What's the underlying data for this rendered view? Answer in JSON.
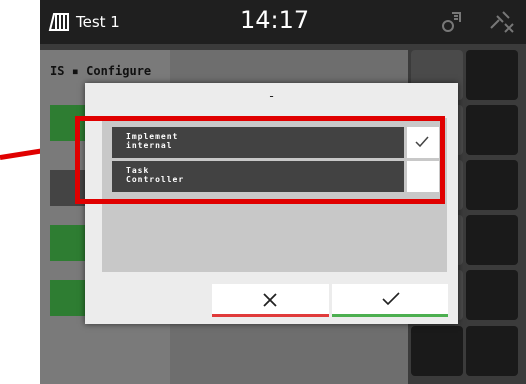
{
  "header": {
    "title": "Test 1",
    "time": "14:17"
  },
  "background": {
    "header_text": "IS ▪ Configure"
  },
  "dialog": {
    "title": "-",
    "options": [
      {
        "label": "Implement\ninternal",
        "checked": true
      },
      {
        "label": "Task\nController",
        "checked": false
      }
    ],
    "cancel_icon": "x-icon",
    "confirm_icon": "checkmark-icon"
  },
  "annotation": {
    "highlight_color": "#e00000"
  },
  "colors": {
    "cancel_accent": "#e03a3a",
    "confirm_accent": "#4caf50"
  }
}
